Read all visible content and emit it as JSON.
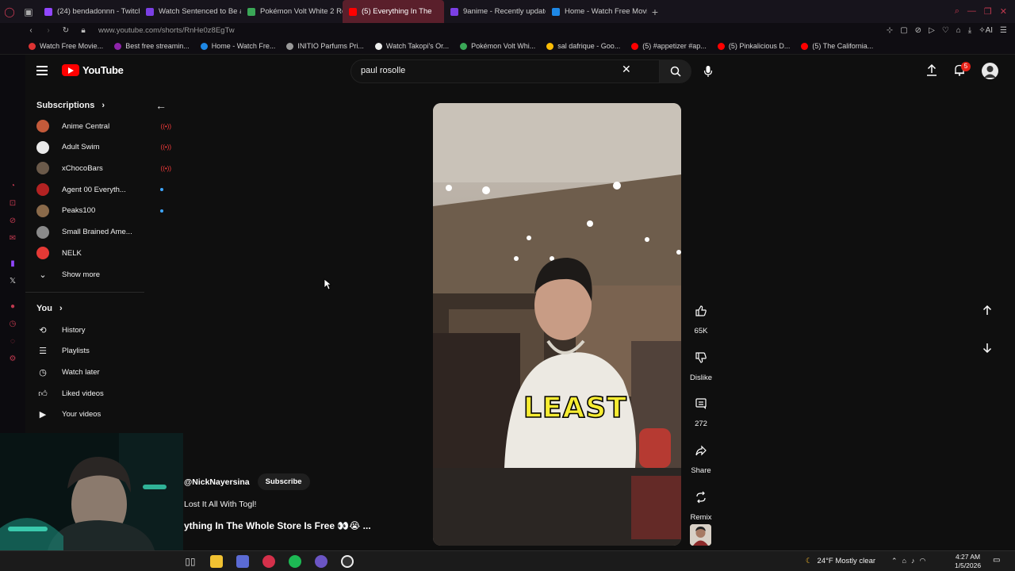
{
  "browser": {
    "tabs": [
      {
        "label": "(24) bendadonnn - Twitch",
        "color": "#9146ff"
      },
      {
        "label": "Watch Sentenced to Be a",
        "color": "#7b3fe4"
      },
      {
        "label": "Pokémon Volt White 2 Re",
        "color": "#3aa757"
      },
      {
        "label": "(5) Everything In The",
        "color": "#ff0000",
        "active": true
      },
      {
        "label": "9anime - Recently update",
        "color": "#7b3fe4"
      },
      {
        "label": "Home - Watch Free Movie",
        "color": "#1e88e5"
      }
    ],
    "url": "www.youtube.com/shorts/RnHe0z8EgTw",
    "bookmarks": [
      {
        "label": "Watch Free Movie...",
        "color": "#d33"
      },
      {
        "label": "Best free streamin...",
        "color": "#8e24aa"
      },
      {
        "label": "Home - Watch Fre...",
        "color": "#1e88e5"
      },
      {
        "label": "INITIO Parfums Pri...",
        "color": "#999"
      },
      {
        "label": "Watch Takopi's Or...",
        "color": "#eee"
      },
      {
        "label": "Pokémon Volt Whi...",
        "color": "#3aa757"
      },
      {
        "label": "sal dafrique - Goo...",
        "color": "#fbbc05"
      },
      {
        "label": "(5) #appetizer #ap...",
        "color": "#ff0000"
      },
      {
        "label": "(5) Pinkalicious D...",
        "color": "#ff0000"
      },
      {
        "label": "(5) The California...",
        "color": "#ff0000"
      }
    ]
  },
  "youtube": {
    "logo_text": "YouTube",
    "search": {
      "value": "paul rosolle"
    },
    "notifications_count": "5"
  },
  "sidebar": {
    "subscriptions_label": "Subscriptions",
    "channels": [
      {
        "name": "Anime Central",
        "color": "#c35a3a",
        "status": "live"
      },
      {
        "name": "Adult Swim",
        "color": "#eaeaea",
        "status": "live"
      },
      {
        "name": "xChocoBars",
        "color": "#6b5a4a",
        "status": "live"
      },
      {
        "name": "Agent 00 Everyth...",
        "color": "#b32222",
        "status": "new"
      },
      {
        "name": "Peaks100",
        "color": "#8a6a4a",
        "status": "new"
      },
      {
        "name": "Small Brained Ame...",
        "color": "#8a8a8a",
        "status": ""
      },
      {
        "name": "NELK",
        "color": "#e53935",
        "status": ""
      }
    ],
    "show_more": "Show more",
    "you_label": "You",
    "you_items": [
      {
        "label": "History",
        "icon": "history-icon"
      },
      {
        "label": "Playlists",
        "icon": "playlists-icon"
      },
      {
        "label": "Watch later",
        "icon": "watch-later-icon"
      },
      {
        "label": "Liked videos",
        "icon": "liked-videos-icon"
      },
      {
        "label": "Your videos",
        "icon": "your-videos-icon"
      }
    ]
  },
  "short": {
    "caption": "LEAST",
    "channel": "@NickNayersina",
    "subscribe": "Subscribe",
    "subtitle": "Lost It All With Togl!",
    "title": "ything In The Whole Store Is Free 👀😭 ...",
    "actions": {
      "likes": "65K",
      "dislike": "Dislike",
      "comments": "272",
      "share": "Share",
      "remix": "Remix"
    }
  },
  "taskbar": {
    "weather": "24°F  Mostly clear",
    "time": "4:27 AM",
    "date": "1/5/2026"
  }
}
